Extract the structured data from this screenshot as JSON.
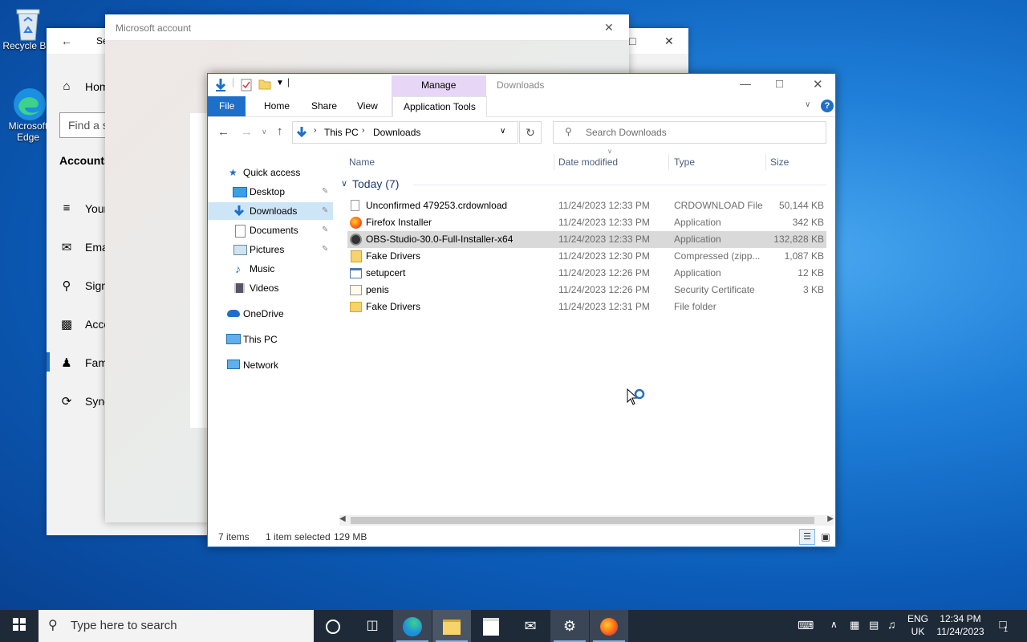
{
  "desktop": {
    "icons": [
      {
        "label": "Recycle Bin",
        "icon": "recycle-bin-icon"
      },
      {
        "label": "Microsoft Edge",
        "icon": "edge-icon"
      }
    ]
  },
  "settings_window": {
    "title": "Se",
    "home": "Home",
    "search_placeholder": "Find a s",
    "section": "Accounts",
    "nav": [
      {
        "label": "Your",
        "icon": "person-info-icon"
      },
      {
        "label": "Ema",
        "icon": "email-icon"
      },
      {
        "label": "Sign",
        "icon": "key-icon"
      },
      {
        "label": "Acce",
        "icon": "briefcase-icon"
      },
      {
        "label": "Fami",
        "icon": "family-icon"
      },
      {
        "label": "Sync",
        "icon": "sync-icon"
      }
    ]
  },
  "ms_account_window": {
    "title": "Microsoft account"
  },
  "explorer": {
    "title": "Downloads",
    "ribbon": {
      "context_group": "Manage",
      "tabs": [
        "File",
        "Home",
        "Share",
        "View",
        "Application Tools"
      ]
    },
    "breadcrumb": [
      "This PC",
      "Downloads"
    ],
    "search_placeholder": "Search Downloads",
    "nav_pane": [
      {
        "label": "Quick access",
        "icon": "star-icon",
        "pinned": false
      },
      {
        "label": "Desktop",
        "icon": "desktop-folder-icon",
        "pinned": true
      },
      {
        "label": "Downloads",
        "icon": "download-arrow-icon",
        "pinned": true,
        "selected": true
      },
      {
        "label": "Documents",
        "icon": "documents-icon",
        "pinned": true
      },
      {
        "label": "Pictures",
        "icon": "pictures-icon",
        "pinned": true
      },
      {
        "label": "Music",
        "icon": "music-note-icon",
        "pinned": false
      },
      {
        "label": "Videos",
        "icon": "videos-icon",
        "pinned": false
      },
      {
        "label": "OneDrive",
        "icon": "cloud-icon",
        "pinned": false
      },
      {
        "label": "This PC",
        "icon": "computer-icon",
        "pinned": false
      },
      {
        "label": "Network",
        "icon": "network-icon",
        "pinned": false
      }
    ],
    "columns": [
      "Name",
      "Date modified",
      "Type",
      "Size"
    ],
    "group_header": "Today (7)",
    "files": [
      {
        "name": "Unconfirmed 479253.crdownload",
        "date": "11/24/2023 12:33 PM",
        "type": "CRDOWNLOAD File",
        "size": "50,144 KB",
        "icon": "blank-file-icon"
      },
      {
        "name": "Firefox Installer",
        "date": "11/24/2023 12:33 PM",
        "type": "Application",
        "size": "342 KB",
        "icon": "firefox-icon"
      },
      {
        "name": "OBS-Studio-30.0-Full-Installer-x64",
        "date": "11/24/2023 12:33 PM",
        "type": "Application",
        "size": "132,828 KB",
        "icon": "obs-icon",
        "selected": true
      },
      {
        "name": "Fake Drivers",
        "date": "11/24/2023 12:30 PM",
        "type": "Compressed (zipp...",
        "size": "1,087 KB",
        "icon": "zip-folder-icon"
      },
      {
        "name": "setupcert",
        "date": "11/24/2023 12:26 PM",
        "type": "Application",
        "size": "12 KB",
        "icon": "application-icon"
      },
      {
        "name": "penis",
        "date": "11/24/2023 12:26 PM",
        "type": "Security Certificate",
        "size": "3 KB",
        "icon": "certificate-icon"
      },
      {
        "name": "Fake Drivers",
        "date": "11/24/2023 12:31 PM",
        "type": "File folder",
        "size": "",
        "icon": "folder-icon"
      }
    ],
    "status": {
      "count": "7 items",
      "selected": "1 item selected",
      "size": "129 MB"
    }
  },
  "taskbar": {
    "search_placeholder": "Type here to search",
    "apps": [
      "cortana-icon",
      "task-view-icon",
      "edge-icon",
      "file-explorer-icon",
      "store-icon",
      "mail-icon",
      "settings-gear-icon",
      "firefox-icon"
    ],
    "language": "ENG",
    "region": "UK",
    "time": "12:34 PM",
    "date": "11/24/2023",
    "notifications": "1"
  },
  "colors": {
    "accent": "#1e6fc9",
    "manage_band": "#e8d6f7",
    "selection": "#cde6f7"
  }
}
